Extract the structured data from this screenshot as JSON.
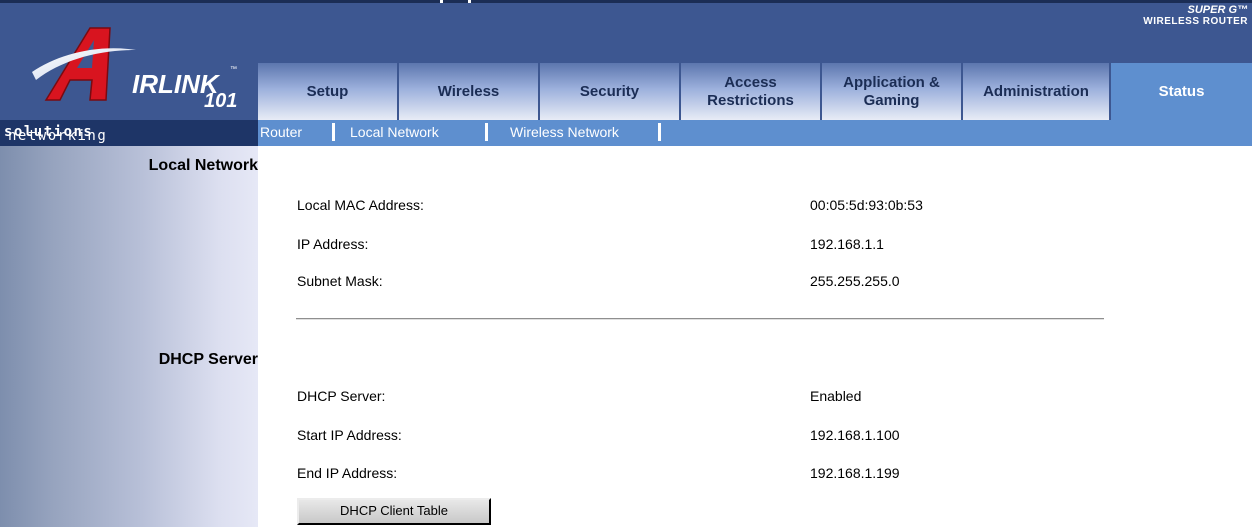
{
  "brand": {
    "logo_text": "IRLINK",
    "logo_trademark": "™",
    "logo_number": "101",
    "tagline_regular": "networking",
    "tagline_bold": "solutions",
    "product_badge_line1": "SUPER G™",
    "product_badge_line2": "WIRELESS ROUTER",
    "colors": {
      "header": "#3d5791",
      "active_tab": "#5e8fcf",
      "tagline_bar": "#1e3567"
    }
  },
  "tabs": [
    {
      "label": "Setup",
      "active": false
    },
    {
      "label": "Wireless",
      "active": false
    },
    {
      "label": "Security",
      "active": false
    },
    {
      "label": "Access Restrictions",
      "active": false
    },
    {
      "label": "Application & Gaming",
      "active": false
    },
    {
      "label": "Administration",
      "active": false
    },
    {
      "label": "Status",
      "active": true
    }
  ],
  "subnav": [
    {
      "label": "Router"
    },
    {
      "label": "Local Network"
    },
    {
      "label": "Wireless Network"
    }
  ],
  "sections": {
    "local_network": {
      "title": "Local Network",
      "rows": [
        {
          "label": "Local MAC Address:",
          "value": "00:05:5d:93:0b:53"
        },
        {
          "label": "IP Address:",
          "value": "192.168.1.1"
        },
        {
          "label": "Subnet Mask:",
          "value": "255.255.255.0"
        }
      ]
    },
    "dhcp_server": {
      "title": "DHCP Server",
      "rows": [
        {
          "label": "DHCP Server:",
          "value": "Enabled"
        },
        {
          "label": "Start IP Address:",
          "value": "192.168.1.100"
        },
        {
          "label": "End IP Address:",
          "value": "192.168.1.199"
        }
      ],
      "button_label": "DHCP Client Table"
    }
  }
}
